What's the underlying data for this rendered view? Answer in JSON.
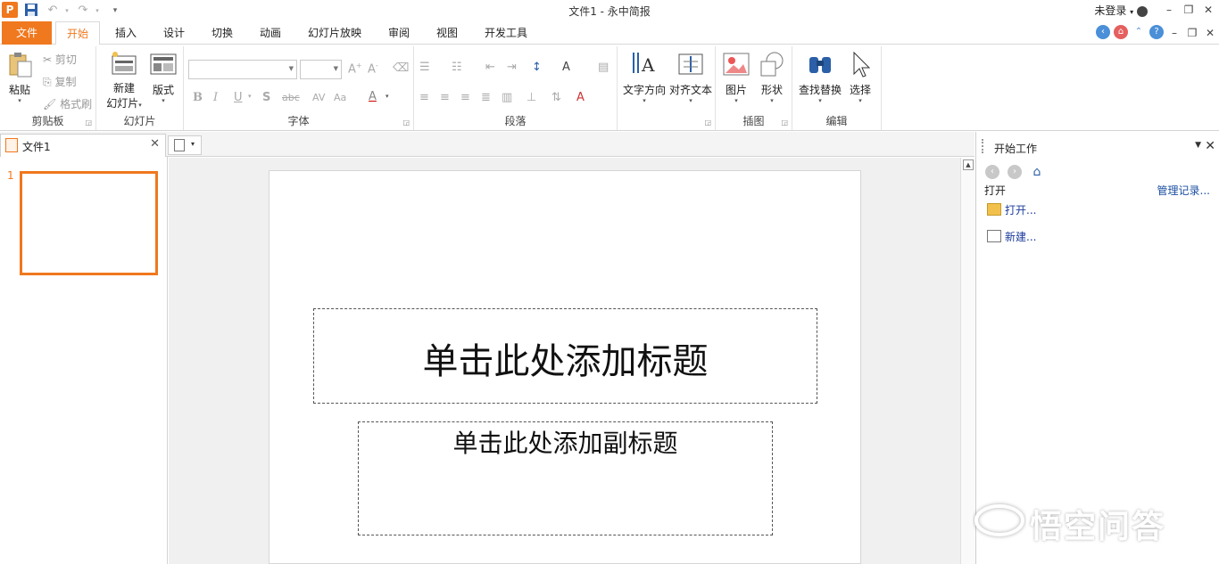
{
  "titlebar": {
    "app_logo": "P",
    "title": "文件1 - 永中简报",
    "login": "未登录"
  },
  "menu": {
    "tabs": [
      "文件",
      "开始",
      "插入",
      "设计",
      "切换",
      "动画",
      "幻灯片放映",
      "审阅",
      "视图",
      "开发工具"
    ]
  },
  "ribbon": {
    "clipboard": {
      "paste": "粘贴",
      "cut": "剪切",
      "copy": "复制",
      "format_painter": "格式刷",
      "label": "剪贴板"
    },
    "slides": {
      "new_slide_line1": "新建",
      "new_slide_line2": "幻灯片",
      "layout": "版式",
      "label": "幻灯片"
    },
    "font": {
      "label": "字体",
      "bold": "B",
      "italic": "I",
      "underline": "U",
      "shadow": "S",
      "strike": "abc",
      "spacing": "AV",
      "case": "Aa",
      "color": "A",
      "grow": "A",
      "shrink": "A"
    },
    "paragraph": {
      "label": "段落"
    },
    "text_direction": "文字方向",
    "align_text": "对齐文本",
    "drawing": {
      "picture": "图片",
      "shape": "形状",
      "label": "插图"
    },
    "editing": {
      "find_replace": "查找替换",
      "select": "选择",
      "label": "编辑"
    }
  },
  "document": {
    "tab_name": "文件1",
    "slide_number": "1",
    "title_placeholder": "单击此处添加标题",
    "subtitle_placeholder": "单击此处添加副标题"
  },
  "taskpane": {
    "title": "开始工作",
    "section": "打开",
    "manage": "管理记录...",
    "open_link": "打开...",
    "new_link": "新建..."
  },
  "watermark": {
    "text": "悟空问答"
  },
  "colors": {
    "accent": "#f0781e",
    "link": "#1a3a9a"
  }
}
